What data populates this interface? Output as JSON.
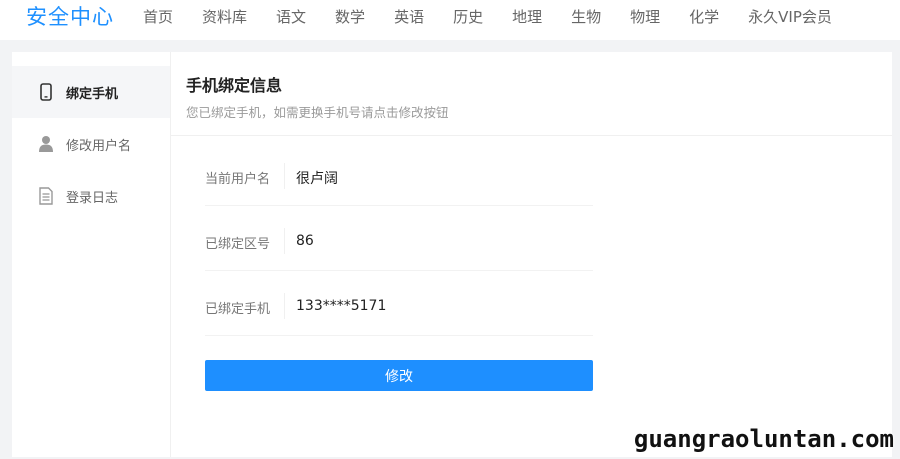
{
  "header": {
    "brand": "安全中心",
    "nav": [
      "首页",
      "资料库",
      "语文",
      "数学",
      "英语",
      "历史",
      "地理",
      "生物",
      "物理",
      "化学",
      "永久VIP会员"
    ]
  },
  "sidebar": {
    "items": [
      {
        "label": "绑定手机",
        "icon": "phone-icon",
        "active": true
      },
      {
        "label": "修改用户名",
        "icon": "user-icon",
        "active": false
      },
      {
        "label": "登录日志",
        "icon": "log-icon",
        "active": false
      }
    ]
  },
  "main": {
    "title": "手机绑定信息",
    "subtitle": "您已绑定手机，如需更换手机号请点击修改按钮",
    "fields": [
      {
        "label": "当前用户名",
        "value": "很卢阔"
      },
      {
        "label": "已绑定区号",
        "value": "86"
      },
      {
        "label": "已绑定手机",
        "value": "133****5171"
      }
    ],
    "edit_button": "修改"
  },
  "watermark": "guangraoluntan.com",
  "colors": {
    "accent": "#1e8fff",
    "brand": "#1e90ff",
    "page_bg": "#f2f3f5"
  }
}
